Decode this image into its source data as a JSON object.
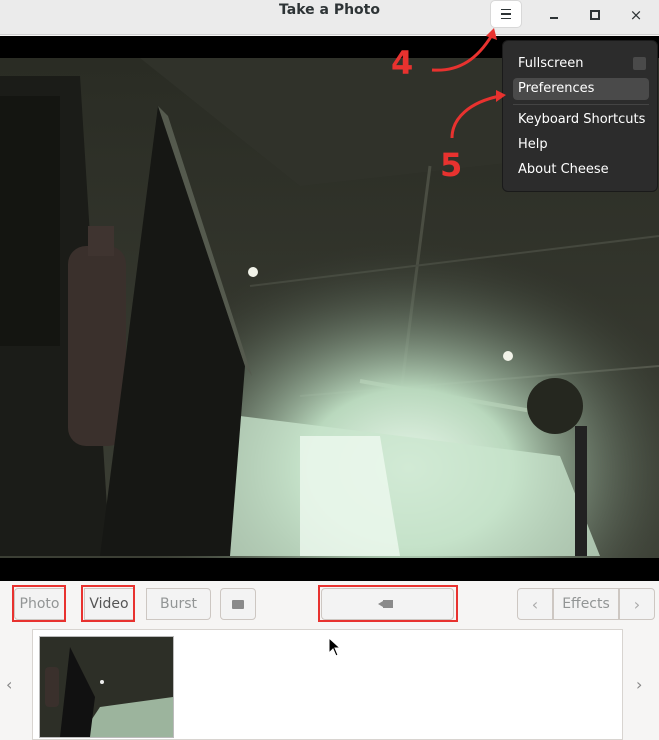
{
  "window": {
    "title": "Take a Photo",
    "menu_icon": "hamburger-icon",
    "minimize_icon": "minimize-icon",
    "maximize_icon": "maximize-icon",
    "close_label": "×"
  },
  "menu": {
    "fullscreen": "Fullscreen",
    "preferences": "Preferences",
    "keyboard_shortcuts": "Keyboard Shortcuts",
    "help": "Help",
    "about": "About Cheese"
  },
  "annotations": {
    "step4": "4",
    "step5": "5",
    "color": "#e8322f"
  },
  "toolbar": {
    "photo": "Photo",
    "video": "Video",
    "burst": "Burst",
    "effects": "Effects",
    "prev": "‹",
    "next": "›"
  },
  "strip": {
    "prev": "‹",
    "next": "›"
  }
}
